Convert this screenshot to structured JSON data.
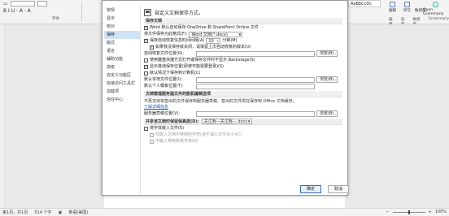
{
  "ribbon": {
    "font_row": "B  I  U  ·  A  ·  A",
    "group_label_font": "字体",
    "style_sample": "AaBbCcDc",
    "right_buttons": [
      {
        "label": "编辑"
      },
      {
        "label": "听写"
      },
      {
        "label": "敏感度"
      },
      {
        "label": "Grammarly"
      }
    ],
    "open_grammarly": "Open Grammarly",
    "group_labels": [
      "编辑",
      "语音",
      "敏感度",
      "Grammarly"
    ]
  },
  "status_bar": {
    "page": "第1页，共1页",
    "words": "514 个字",
    "language": "英语(美国)",
    "zoom": "100%",
    "zoom_level_percent": 100
  },
  "dialog": {
    "nav_items": [
      {
        "label": "常规",
        "active": false
      },
      {
        "label": "显示",
        "active": false
      },
      {
        "label": "校对",
        "active": false
      },
      {
        "label": "保存",
        "active": true
      },
      {
        "label": "版式",
        "active": false
      },
      {
        "label": "语言",
        "active": false
      },
      {
        "label": "辅助功能",
        "active": false
      },
      {
        "label": "高级",
        "active": false
      },
      {
        "label": "自定义功能区",
        "active": false
      },
      {
        "label": "快速访问工具栏",
        "active": false
      },
      {
        "label": "加载项",
        "active": false
      },
      {
        "label": "信任中心",
        "active": false
      }
    ],
    "header_text": "自定义文档保存方式。",
    "save_section": {
      "title": "保存文档",
      "autosave_label": "Word 默认自动保存 OneDrive 和 SharePoint Online 文件",
      "format_label": "将文件保存为此格式(F):",
      "format_value": "Word 文档(*.docx)",
      "autorecover_label": "保存自动恢复信息时间间隔(A)",
      "autorecover_minutes": "10",
      "minutes_unit": "分钟(M)",
      "keep_last_label": "如果我没保存就关闭，请保留上次自动恢复的版本(U)",
      "autorecover_location_label": "自动恢复文件位置(R):",
      "browse_1": "浏览(B)...",
      "backstage_label": "使用键盘快捷方式打开或保存文件时不显示 Backstage(S)",
      "show_more_label": "显示其他保存位置(即使可能需要登录)(S)",
      "default_computer_label": "默认情况下保存到计算机(C)",
      "local_default_label": "默认本地文件位置(I):",
      "browse_2": "浏览(B)...",
      "personal_templates_label": "默认个人模板位置(T):"
    },
    "offline_section": {
      "title": "文档管理服务器文件的脱机编辑选项",
      "info": "不再支持将签出的文件保存到服务器草稿。签出的文件现在保存到 Office 文档缓存。",
      "learn_more": "了解详细信息",
      "drafts_label": "服务器草稿位置(V):",
      "browse_3": "浏览(B)..."
    },
    "share_section": {
      "title": "共享该文档时保留保真度(D):",
      "doc_value": "关注我—关注我—.docx",
      "embed_fonts_label": "将字体嵌入文件(E)",
      "embed_only_used_label": "仅嵌入文档中使用的字符(适于减小文件大小)(C)",
      "no_common_label": "不嵌入常用系统字体(N)"
    },
    "ok_label": "确定",
    "cancel_label": "取消"
  },
  "colors": {
    "accent": "#2b6fc4",
    "nav_active": "#cfe3f7",
    "section_bg": "#f0f0f0"
  }
}
